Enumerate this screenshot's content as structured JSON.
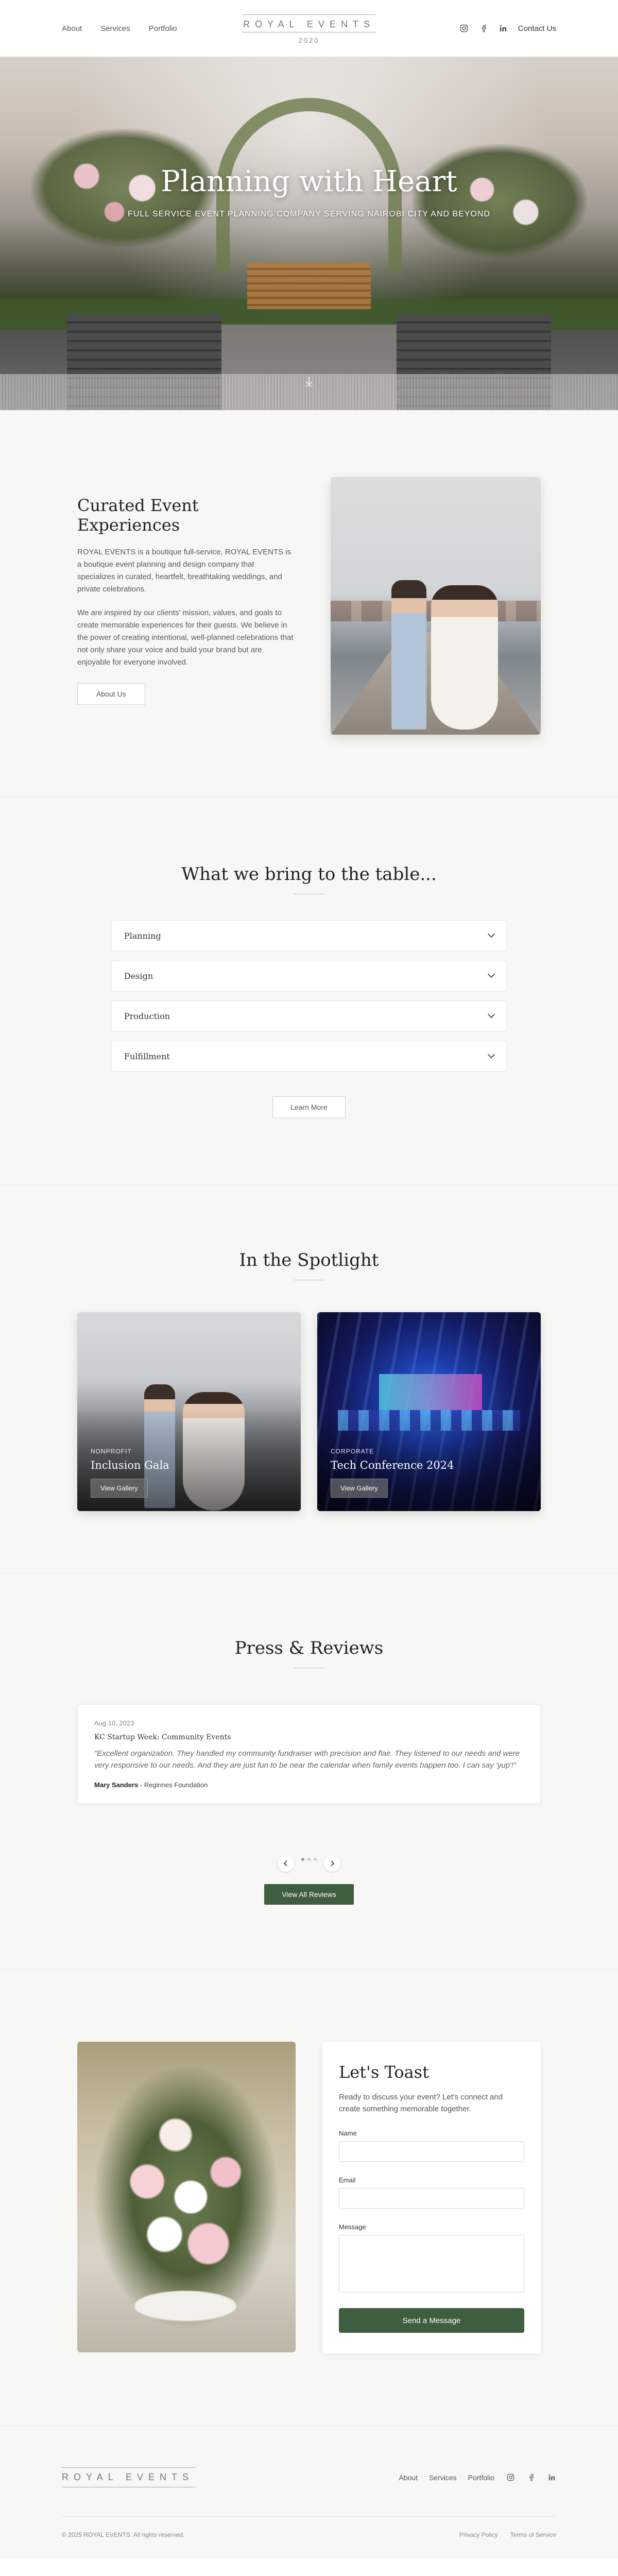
{
  "header": {
    "nav": [
      "About",
      "Services",
      "Portfolio"
    ],
    "logo_name": "ROYAL EVENTS",
    "logo_year": "2020",
    "social_icons": [
      "instagram-icon",
      "facebook-icon",
      "linkedin-icon"
    ],
    "contact_label": "Contact Us"
  },
  "hero": {
    "title": "Planning with Heart",
    "subtitle": "FULL SERVICE EVENT PLANNING COMPANY SERVING NAIROBI CITY AND BEYOND",
    "scroll_icon": "arrow-down-icon"
  },
  "about": {
    "title": "Curated Event Experiences",
    "para1": "ROYAL EVENTS is a boutique full-service, ROYAL EVENTS is a boutique event planning and design company that specializes in curated, heartfelt, breathtaking weddings, and private celebrations.",
    "para2": "We are inspired by our clients' mission, values, and goals to create memorable experiences for their guests. We believe in the power of creating intentional, well-planned celebrations that not only share your voice and build your brand but are enjoyable for everyone involved.",
    "button": "About Us"
  },
  "services": {
    "title": "What we bring to the table...",
    "items": [
      "Planning",
      "Design",
      "Production",
      "Fulfillment"
    ],
    "button": "Learn More"
  },
  "spotlight": {
    "title": "In the Spotlight",
    "cards": [
      {
        "category": "NONPROFIT",
        "name": "Inclusion Gala",
        "button": "View Gallery"
      },
      {
        "category": "CORPORATE",
        "name": "Tech Conference 2024",
        "button": "View Gallery"
      }
    ]
  },
  "reviews": {
    "title": "Press & Reviews",
    "items": [
      {
        "date": "Aug 10, 2023",
        "title": "KC Startup Week: Community Events",
        "quote": "\"Excellent organization. They handled my community fundraiser with precision and flair. They listened to our needs and were very responsive to our needs. And they are just fun to be near the calendar when family events happen too. I can say 'yup'!\"",
        "author": "Mary Sanders",
        "org": " - Reginnes Foundation"
      }
    ],
    "dot_count": 3,
    "active_dot": 0,
    "prev_icon": "chevron-left-icon",
    "next_icon": "chevron-right-icon",
    "button": "View All Reviews"
  },
  "contact": {
    "title": "Let's Toast",
    "intro": "Ready to discuss your event? Let's connect and create something memorable together.",
    "fields": [
      {
        "label": "Name",
        "value": ""
      },
      {
        "label": "Email",
        "value": ""
      },
      {
        "label": "Message",
        "value": ""
      }
    ],
    "submit": "Send a Message"
  },
  "footer": {
    "logo_name": "ROYAL EVENTS",
    "nav": [
      "About",
      "Services",
      "Portfolio"
    ],
    "social_icons": [
      "instagram-icon",
      "facebook-icon",
      "linkedin-icon"
    ],
    "copyright": "© 2025 ROYAL EVENTS. All rights reserved.",
    "legal": [
      "Privacy Policy",
      "Terms of Service"
    ]
  },
  "colors": {
    "accent_green": "#3f5e3f",
    "section_bg": "#f7f7f6"
  }
}
